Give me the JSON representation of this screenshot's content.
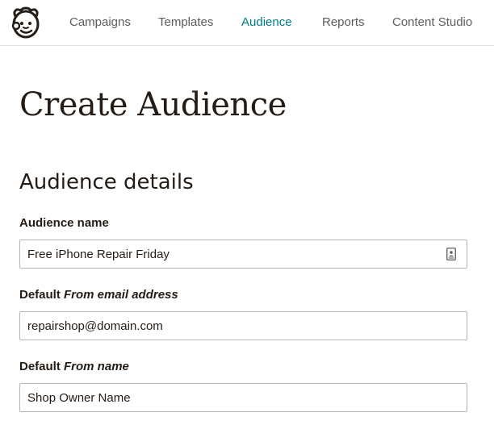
{
  "nav": {
    "items": [
      {
        "label": "Campaigns"
      },
      {
        "label": "Templates"
      },
      {
        "label": "Audience"
      },
      {
        "label": "Reports"
      },
      {
        "label": "Content Studio"
      }
    ],
    "active": "Audience",
    "active_color": "#007c89"
  },
  "page": {
    "title": "Create Audience"
  },
  "section": {
    "title": "Audience details"
  },
  "form": {
    "audience_name": {
      "label": "Audience name",
      "value": "Free iPhone Repair Friday",
      "icon": "contact-card-icon"
    },
    "from_email": {
      "label_prefix": "Default ",
      "label_emphasis": "From email address",
      "value": "repairshop@domain.com"
    },
    "from_name": {
      "label_prefix": "Default ",
      "label_emphasis": "From name",
      "value": "Shop Owner Name"
    }
  }
}
